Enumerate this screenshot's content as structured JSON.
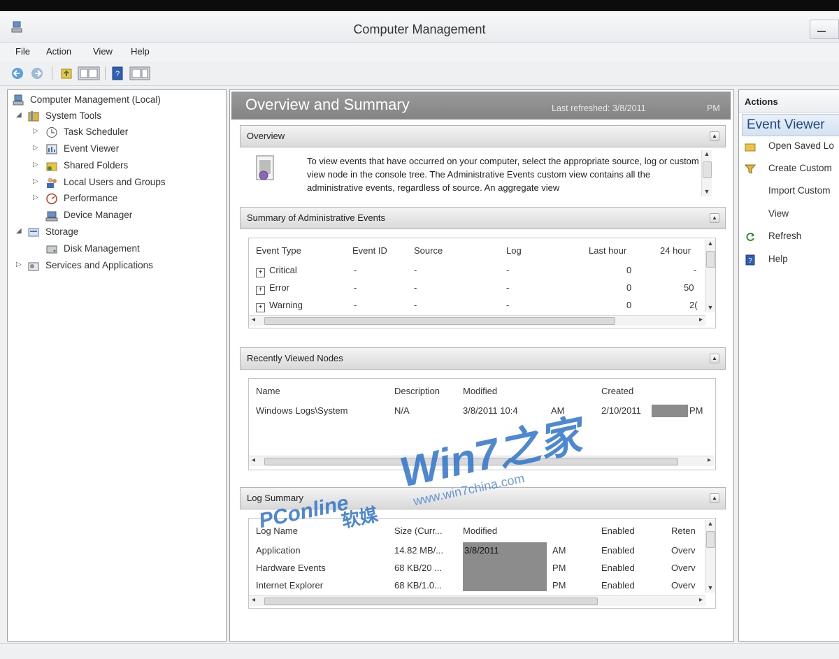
{
  "window": {
    "title": "Computer Management"
  },
  "menu": [
    "File",
    "Action",
    "View",
    "Help"
  ],
  "tree": {
    "root": "Computer Management (Local)",
    "items": [
      {
        "label": "System Tools",
        "icon": "tools-icon"
      },
      {
        "label": "Task Scheduler",
        "icon": "clock-icon"
      },
      {
        "label": "Event Viewer",
        "icon": "event-viewer-icon"
      },
      {
        "label": "Shared Folders",
        "icon": "shared-folder-icon"
      },
      {
        "label": "Local Users and Groups",
        "icon": "users-icon"
      },
      {
        "label": "Performance",
        "icon": "performance-icon"
      },
      {
        "label": "Device Manager",
        "icon": "device-manager-icon"
      },
      {
        "label": "Storage",
        "icon": "storage-icon"
      },
      {
        "label": "Disk Management",
        "icon": "disk-icon"
      },
      {
        "label": "Services and Applications",
        "icon": "services-icon"
      }
    ]
  },
  "overview": {
    "title": "Overview and Summary",
    "last_refreshed": "Last refreshed: 3/8/2011",
    "last_refreshed_suffix": "PM"
  },
  "sections": {
    "overview": {
      "title": "Overview",
      "text": "To view events that have occurred on your computer, select the appropriate source, log or custom view node in the console tree. The Administrative Events custom view contains all the administrative events, regardless of source. An aggregate view"
    },
    "summary": {
      "title": "Summary of Administrative Events",
      "headers": [
        "Event Type",
        "Event ID",
        "Source",
        "Log",
        "Last hour",
        "24 hour"
      ],
      "rows": [
        {
          "type": "Critical",
          "id": "-",
          "source": "-",
          "log": "-",
          "last_hour": "0",
          "h24": "-"
        },
        {
          "type": "Error",
          "id": "-",
          "source": "-",
          "log": "-",
          "last_hour": "0",
          "h24": "50"
        },
        {
          "type": "Warning",
          "id": "-",
          "source": "-",
          "log": "-",
          "last_hour": "0",
          "h24": "2("
        }
      ]
    },
    "recent": {
      "title": "Recently Viewed Nodes",
      "headers": [
        "Name",
        "Description",
        "Modified",
        "Created"
      ],
      "rows": [
        {
          "name": "Windows Logs\\System",
          "description": "N/A",
          "modified": "3/8/2011 10:4",
          "modified_suffix": "AM",
          "created": "2/10/2011",
          "created_suffix": "PM"
        }
      ]
    },
    "log": {
      "title": "Log Summary",
      "headers": [
        "Log Name",
        "Size (Curr...",
        "Modified",
        "Enabled",
        "Reten"
      ],
      "rows": [
        {
          "name": "Application",
          "size": "14.82 MB/...",
          "modified": "3/8/2011",
          "suffix": "AM",
          "enabled": "Enabled",
          "retention": "Overv"
        },
        {
          "name": "Hardware Events",
          "size": "68 KB/20 ...",
          "modified": "",
          "suffix": "PM",
          "enabled": "Enabled",
          "retention": "Overv"
        },
        {
          "name": "Internet Explorer",
          "size": "68 KB/1.0...",
          "modified": "",
          "suffix": "PM",
          "enabled": "Enabled",
          "retention": "Overv"
        }
      ]
    }
  },
  "watermark": {
    "brand": "Win7之家",
    "url": "www.win7china.com",
    "pcmag": "PConline",
    "pcmag_cn": "软媒"
  },
  "actions": {
    "header": "Actions",
    "sub": "Event Viewer",
    "items": [
      {
        "label": "Open Saved Lo",
        "icon": "folder-open-icon"
      },
      {
        "label": "Create Custom",
        "icon": "filter-icon"
      },
      {
        "label": "Import Custom",
        "icon": ""
      },
      {
        "label": "View",
        "icon": ""
      },
      {
        "label": "Refresh",
        "icon": "refresh-icon"
      },
      {
        "label": "Help",
        "icon": "help-icon"
      }
    ]
  },
  "colors": {
    "header_gray": "#8a8a8a",
    "watermark_blue": "#2f73c9",
    "watermark_orange": "#f08a1a"
  }
}
